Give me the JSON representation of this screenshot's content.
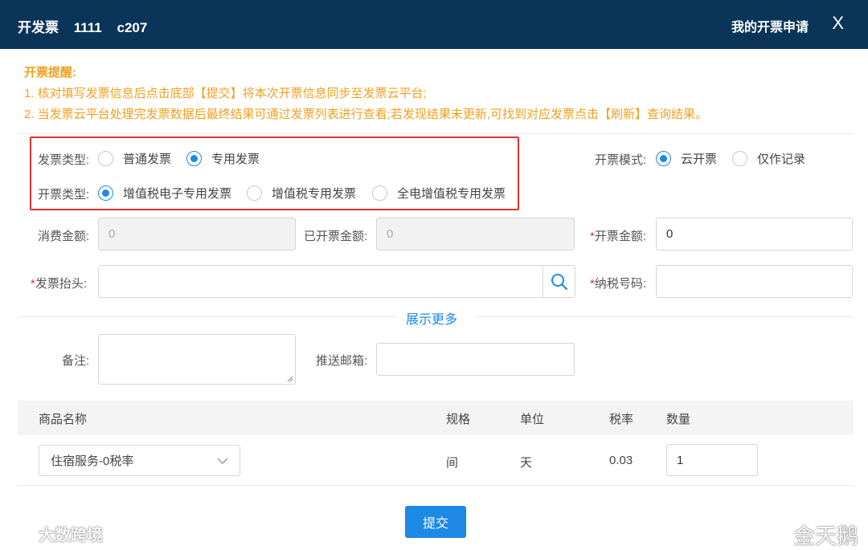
{
  "header": {
    "title_prefix": "开发票",
    "title_num": "1111",
    "title_code": "c207",
    "my_apply": "我的开票申请",
    "close": "X"
  },
  "tips": {
    "title": "开票提醒:",
    "line1": "1. 核对填写发票信息后点击底部【提交】将本次开票信息同步至发票云平台;",
    "line2": "2. 当发票云平台处理完发票数据后最终结果可通过发票列表进行查看;若发现结果未更新,可找到对应发票点击【刷新】查询结果。"
  },
  "invoice_type": {
    "label": "发票类型:",
    "options": [
      "普通发票",
      "专用发票"
    ],
    "selected": "专用发票"
  },
  "issue_type": {
    "label": "开票类型:",
    "options": [
      "增值税电子专用发票",
      "增值税专用发票",
      "全电增值税专用发票"
    ],
    "selected": "增值税电子专用发票"
  },
  "issue_mode": {
    "label": "开票模式:",
    "options": [
      "云开票",
      "仅作记录"
    ],
    "selected": "云开票"
  },
  "amounts": {
    "consume_label": "消费金额:",
    "consume_value": "0",
    "issued_label": "已开票金额:",
    "issued_value": "0",
    "invoice_label": "开票金额:",
    "invoice_value": "0"
  },
  "header_field": {
    "label": "发票抬头:",
    "value": ""
  },
  "tax_no": {
    "label": "纳税号码:",
    "value": ""
  },
  "show_more": "展示更多",
  "remark": {
    "label": "备注:",
    "value": ""
  },
  "email": {
    "label": "推送邮箱:",
    "value": ""
  },
  "table": {
    "headers": [
      "商品名称",
      "规格",
      "单位",
      "税率",
      "数量"
    ],
    "rows": [
      {
        "product": "住宿服务-0税率",
        "spec": "间",
        "unit": "天",
        "rate": "0.03",
        "qty": "1"
      }
    ]
  },
  "submit": "提交",
  "watermark_left": "大数跨境",
  "watermark_right": "金天鹅",
  "colors": {
    "header_bg": "#0b3558",
    "accent": "#1e88e5",
    "tip": "#f0a020",
    "highlight": "#e03131"
  }
}
